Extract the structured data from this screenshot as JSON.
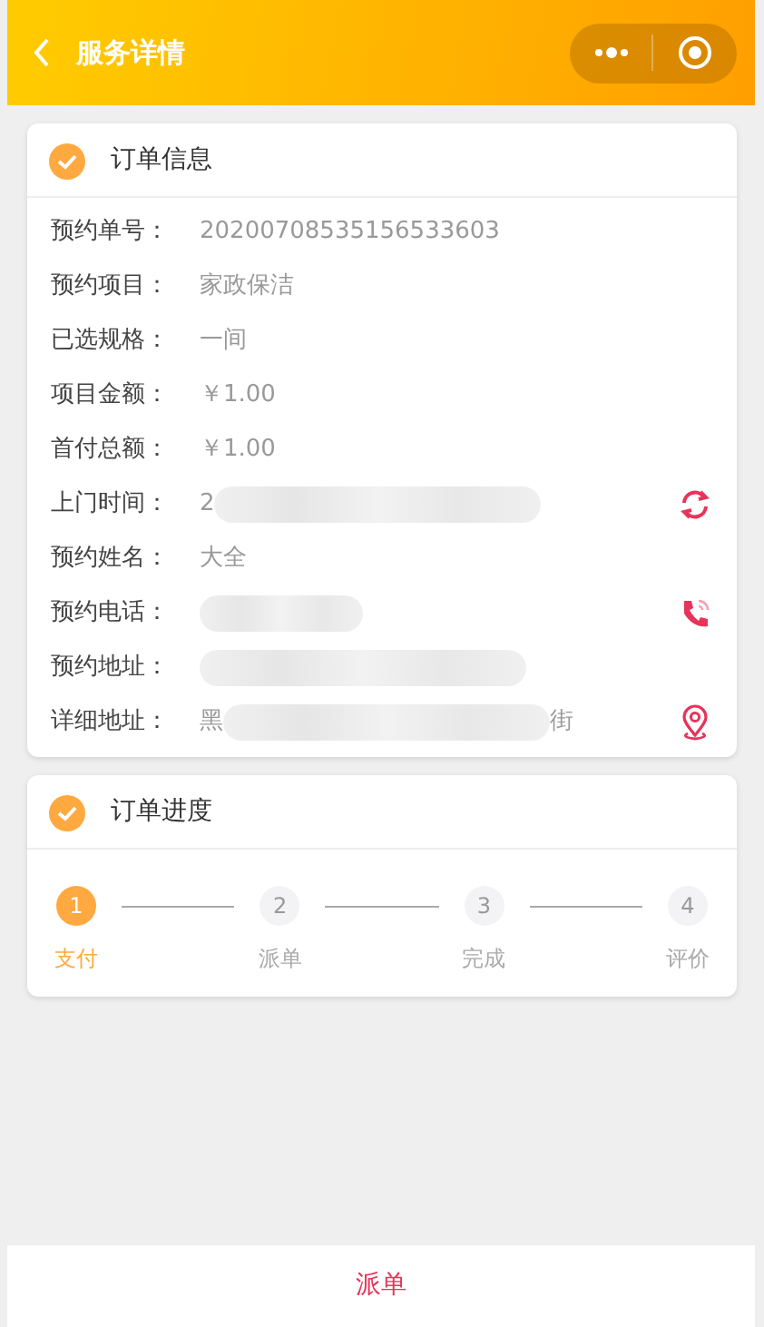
{
  "header": {
    "title": "服务详情"
  },
  "order_info": {
    "title": "订单信息",
    "checked": true,
    "rows": [
      {
        "kind": "text",
        "label": "预约单号：",
        "value": "20200708535156533603"
      },
      {
        "kind": "text",
        "label": "预约项目：",
        "value": "家政保洁"
      },
      {
        "kind": "text",
        "label": "已选规格：",
        "value": "一间"
      },
      {
        "kind": "text",
        "label": "项目金额：",
        "value": "￥1.00"
      },
      {
        "kind": "text",
        "label": "首付总额：",
        "value": "￥1.00"
      },
      {
        "kind": "refresh",
        "label": "上门时间：",
        "value": "2",
        "redacted": true
      },
      {
        "kind": "text",
        "label": "预约姓名：",
        "value": "大全"
      },
      {
        "kind": "call",
        "label": "预约电话：",
        "redacted": true
      },
      {
        "kind": "text",
        "label": "预约地址：",
        "redacted": true
      },
      {
        "kind": "location",
        "label": "详细地址：",
        "value": "黑",
        "tail": "街",
        "redacted": true
      }
    ]
  },
  "progress": {
    "title": "订单进度",
    "checked": true,
    "steps": [
      {
        "number": "1",
        "label": "支付",
        "selected": true
      },
      {
        "number": "2",
        "label": "派单",
        "selected": false
      },
      {
        "number": "3",
        "label": "完成",
        "selected": false
      },
      {
        "number": "4",
        "label": "评价",
        "selected": false
      }
    ]
  },
  "bottom_button": "派单"
}
